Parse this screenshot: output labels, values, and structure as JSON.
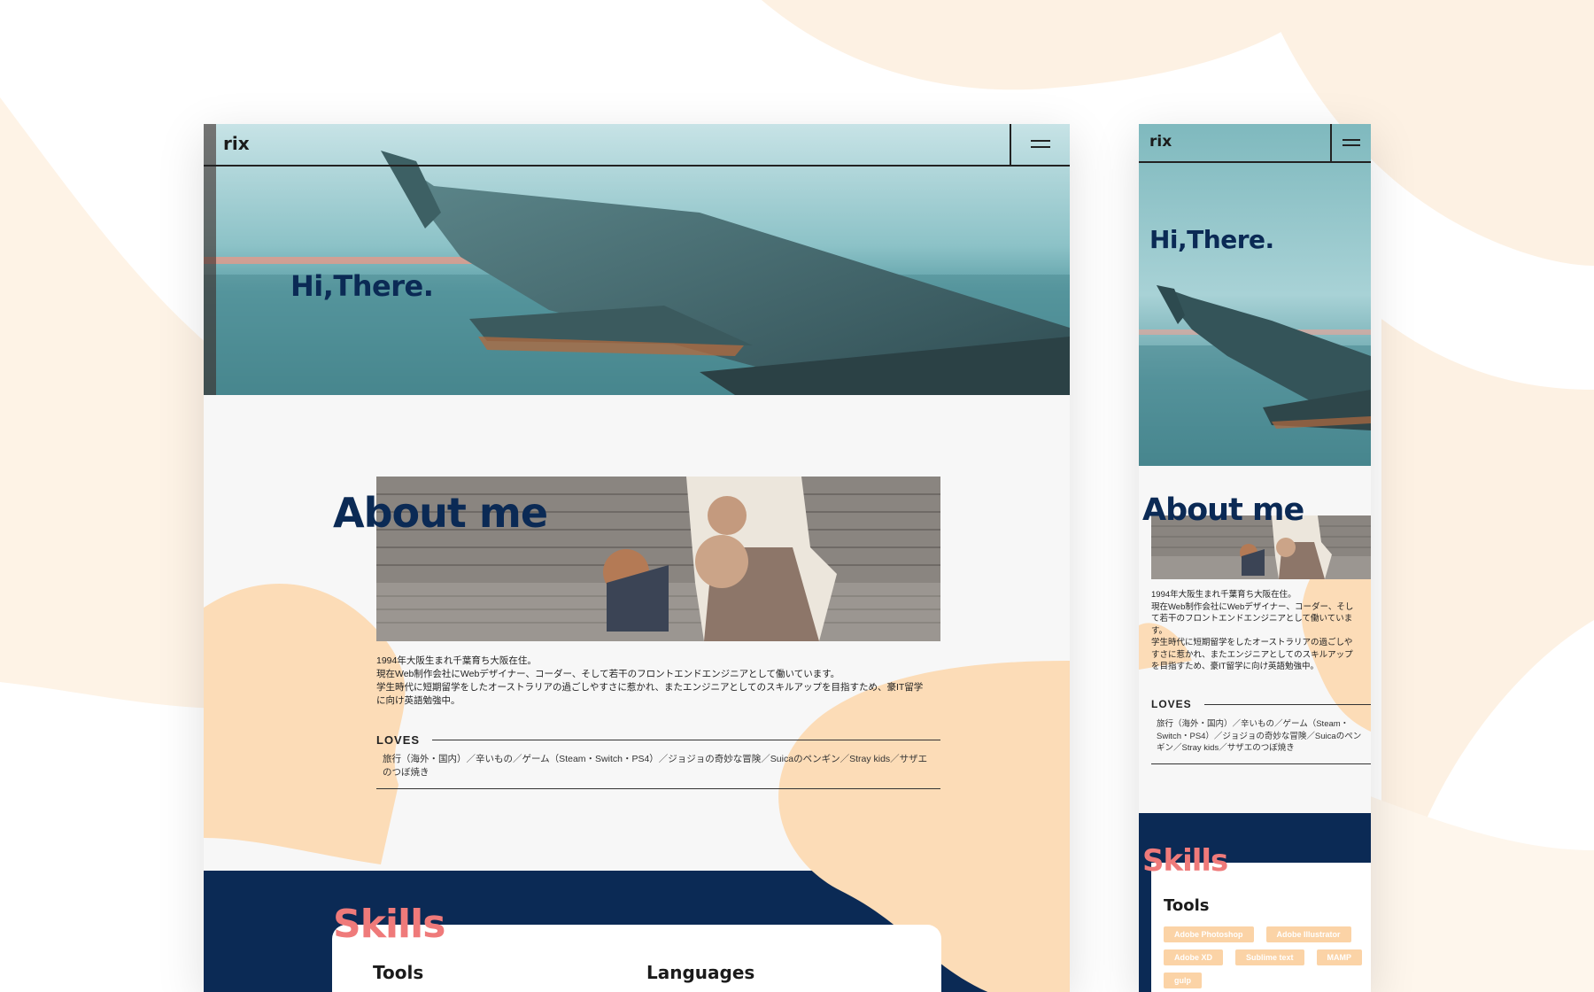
{
  "colors": {
    "navy": "#0b2a55",
    "peach": "#fbd3a6",
    "coral": "#ef7a7a",
    "page_bg": "#f7f7f7"
  },
  "desktop": {
    "header": {
      "logo": "rix",
      "menu_icon": "hamburger-icon"
    },
    "hero": {
      "title": "Hi,There."
    },
    "about": {
      "title": "About me",
      "bio": [
        "1994年大阪生まれ千葉育ち大阪在住。",
        "現在Web制作会社にWebデザイナー、コーダー、そして若干のフロントエンドエンジニアとして働いています。",
        "学生時代に短期留学をしたオーストラリアの過ごしやすさに惹かれ、またエンジニアとしてのスキルアップを目指すため、豪IT留学に向け英語勉強中。"
      ],
      "loves_label": "LOVES",
      "loves_text": "旅行（海外・国内）／辛いもの／ゲーム（Steam・Switch・PS4）／ジョジョの奇妙な冒険／Suicaのペンギン／Stray kids／サザエのつぼ焼き"
    },
    "skills": {
      "title": "Skills",
      "tools_label": "Tools",
      "languages_label": "Languages"
    }
  },
  "mobile": {
    "header": {
      "logo": "rix",
      "menu_icon": "hamburger-icon"
    },
    "hero": {
      "title": "Hi,There."
    },
    "about": {
      "title": "About me",
      "bio": [
        "1994年大阪生まれ千葉育ち大阪在住。",
        "現在Web制作会社にWebデザイナー、コーダー、そして若干のフロントエンドエンジニアとして働いています。",
        "学生時代に短期留学をしたオーストラリアの過ごしやすさに惹かれ、またエンジニアとしてのスキルアップを目指すため、豪IT留学に向け英語勉強中。"
      ],
      "loves_label": "LOVES",
      "loves_text": "旅行（海外・国内）／辛いもの／ゲーム（Steam・Switch・PS4）／ジョジョの奇妙な冒険／Suicaのペンギン／Stray kids／サザエのつぼ焼き"
    },
    "skills": {
      "title": "Skills",
      "tools_label": "Tools",
      "tools": [
        "Adobe Photoshop",
        "Adobe Illustrator",
        "Adobe XD",
        "Sublime text",
        "MAMP",
        "gulp"
      ]
    }
  }
}
